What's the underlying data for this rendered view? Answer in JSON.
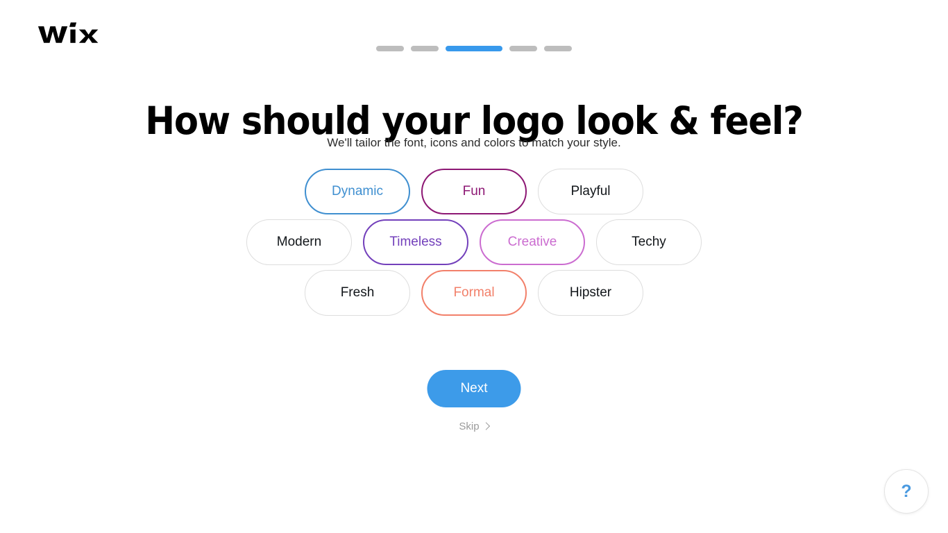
{
  "brand": {
    "name": "WiX",
    "logo_icon": "wix-logo"
  },
  "progress": {
    "total_steps": 5,
    "current_step": 3,
    "active_color": "#3899ec",
    "inactive_color": "#bdbdbd",
    "segments": [
      {
        "state": "inactive"
      },
      {
        "state": "inactive"
      },
      {
        "state": "active"
      },
      {
        "state": "inactive"
      },
      {
        "state": "inactive"
      }
    ]
  },
  "header": {
    "title": "How should your logo look & feel?",
    "subtitle": "We'll tailor the font, icons and colors to match your style."
  },
  "style_chips": {
    "rows": [
      [
        {
          "label": "Dynamic",
          "selected": true,
          "color": "#3f8fd0"
        },
        {
          "label": "Fun",
          "selected": true,
          "color": "#8d1874"
        },
        {
          "label": "Playful",
          "selected": false,
          "color": "#12161a"
        }
      ],
      [
        {
          "label": "Modern",
          "selected": false,
          "color": "#12161a"
        },
        {
          "label": "Timeless",
          "selected": true,
          "color": "#7340bb"
        },
        {
          "label": "Creative",
          "selected": true,
          "color": "#cb6cd0"
        },
        {
          "label": "Techy",
          "selected": false,
          "color": "#12161a"
        }
      ],
      [
        {
          "label": "Fresh",
          "selected": false,
          "color": "#12161a"
        },
        {
          "label": "Formal",
          "selected": true,
          "color": "#f2806a"
        },
        {
          "label": "Hipster",
          "selected": false,
          "color": "#12161a"
        }
      ]
    ],
    "unselected_border": "#dddddd"
  },
  "actions": {
    "next_label": "Next",
    "next_color": "#3d9be9",
    "skip_label": "Skip",
    "skip_icon": "chevron-right-icon"
  },
  "help": {
    "icon": "question-mark-icon",
    "glyph": "?",
    "color": "#4a9ae0"
  }
}
